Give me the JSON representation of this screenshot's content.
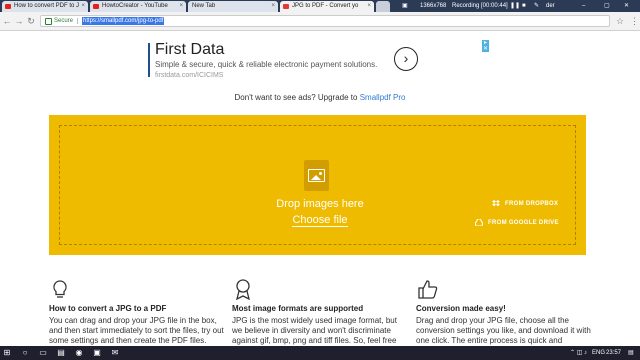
{
  "tabs": [
    {
      "title": "How to convert PDF to J",
      "favicon_color": "#e62117"
    },
    {
      "title": "HowtoCreator - YouTube",
      "favicon_color": "#e62117"
    },
    {
      "title": "New Tab",
      "favicon_color": "#cfcfcf"
    },
    {
      "title": "JPG to PDF - Convert yo",
      "favicon_color": "#e53935"
    }
  ],
  "recorder": {
    "resolution": "1366x768",
    "status": "Recording [00:00:44]",
    "user": "der"
  },
  "address": {
    "secure_label": "Secure",
    "url": "https://smallpdf.com/jpg-to-pdf"
  },
  "ad": {
    "title": "First Data",
    "subtitle": "Simple & secure, quick & reliable electronic payment solutions.",
    "url": "firstdata.com/ICICIMS"
  },
  "no_ads": {
    "text": "Don't want to see ads? Upgrade to ",
    "link": "Smallpdf Pro"
  },
  "dropzone": {
    "title": "Drop images here",
    "choose": "Choose file",
    "dropbox": "FROM DROPBOX",
    "google_drive": "FROM GOOGLE DRIVE",
    "color": "#efbb00"
  },
  "features": [
    {
      "icon": "lightbulb-icon",
      "title": "How to convert a JPG to a PDF",
      "text": "You can drag and drop your JPG file in the box, and then start immediately to sort the files, try out some settings and then create the PDF files."
    },
    {
      "icon": "medal-icon",
      "title": "Most image formats are supported",
      "text": "JPG is the most widely used image format, but we believe in diversity and won't discriminate against gif, bmp, png and tiff files. So, feel free"
    },
    {
      "icon": "thumbs-up-icon",
      "title": "Conversion made easy!",
      "text": "Drag and drop your JPG file, choose all the conversion settings you like, and download it with one click. The entire process is quick and"
    }
  ],
  "taskbar": {
    "time": "23:57",
    "language": "ENG"
  }
}
